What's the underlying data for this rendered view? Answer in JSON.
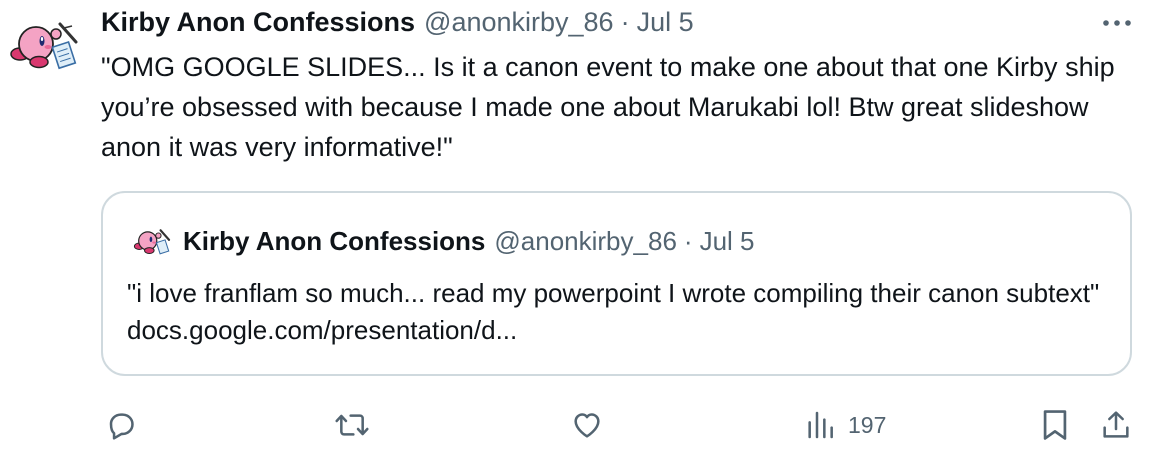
{
  "tweet": {
    "display_name": "Kirby Anon Confessions",
    "handle": "@anonkirby_86",
    "separator": "·",
    "date": "Jul 5",
    "text": "\"OMG GOOGLE SLIDES... Is it a canon event to make one about that one Kirby ship you’re obsessed with because I made one about Marukabi lol! Btw great slideshow anon it was very informative!\"",
    "avatar_icon": "kirby-avatar-icon",
    "more_icon": "more-dots-icon"
  },
  "quote": {
    "display_name": "Kirby Anon Confessions",
    "handle": "@anonkirby_86",
    "separator": "·",
    "date": "Jul 5",
    "text": "\"i love franflam so much... read my powerpoint I wrote compiling their canon subtext\" docs.google.com/presentation/d...",
    "avatar_icon": "kirby-avatar-icon"
  },
  "actions": {
    "reply_icon": "reply-icon",
    "retweet_icon": "retweet-icon",
    "like_icon": "heart-icon",
    "views_icon": "views-chart-icon",
    "views_count": "197",
    "bookmark_icon": "bookmark-icon",
    "share_icon": "share-icon"
  },
  "colors": {
    "text": "#0f1419",
    "secondary": "#536471",
    "border": "#cfd9de",
    "kirby_pink": "#f4a3c4"
  }
}
